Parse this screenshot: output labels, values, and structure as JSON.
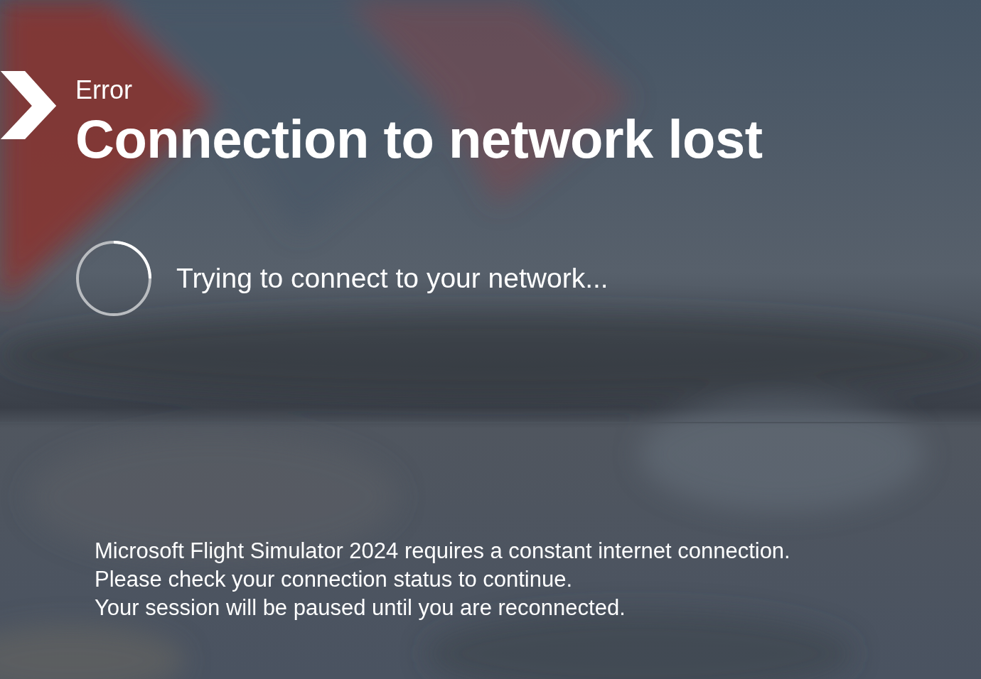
{
  "dialog": {
    "label": "Error",
    "title": "Connection to network lost",
    "status": "Trying to connect to your network...",
    "message": [
      "Microsoft Flight Simulator 2024 requires a constant internet connection.",
      "Please check your connection status to continue.",
      "Your session will be paused until you are reconnected."
    ]
  }
}
